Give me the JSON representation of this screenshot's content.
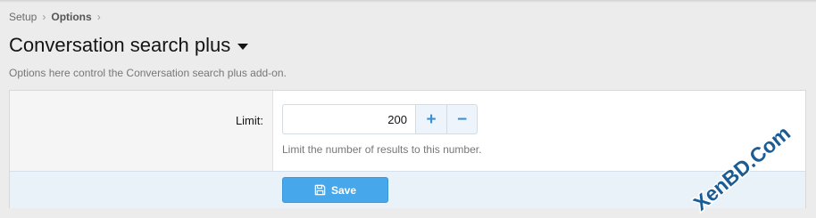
{
  "breadcrumb": {
    "items": [
      "Setup",
      "Options"
    ],
    "separator": "›"
  },
  "page": {
    "title": "Conversation search plus",
    "description": "Options here control the Conversation search plus add-on."
  },
  "option": {
    "label": "Limit:",
    "value": "200",
    "plus": "+",
    "minus": "−",
    "hint": "Limit the number of results to this number."
  },
  "footer": {
    "save_label": "Save",
    "save_icon": "floppy-disk-icon"
  },
  "watermark": {
    "text": "XenBD.Com"
  },
  "colors": {
    "accent": "#47a7eb",
    "footer_bg": "#e9f1f9",
    "stepper_glyph": "#3d8fd4",
    "watermark": "#1b5c94"
  }
}
